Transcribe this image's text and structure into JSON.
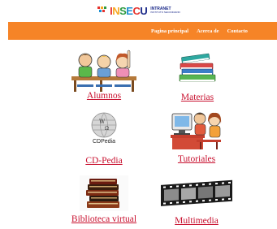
{
  "logo": {
    "brand": "INSECU",
    "line1": "INTRANET",
    "line2": "INSTITUTO SECUNDARIO"
  },
  "nav": {
    "items": [
      "Pagina principal",
      "Acerca de",
      "Contacto"
    ]
  },
  "tiles": {
    "alumnos": "Alumnos",
    "materias": "Materias",
    "cdpedia": "CD-Pedia",
    "cdpedia_logo": "CDPedia",
    "tutoriales": "Tutoriales",
    "biblioteca": "Biblioteca virtual",
    "multimedia": "Multimedia"
  },
  "colors": {
    "navbar": "#f68427",
    "link": "#c8102e"
  }
}
